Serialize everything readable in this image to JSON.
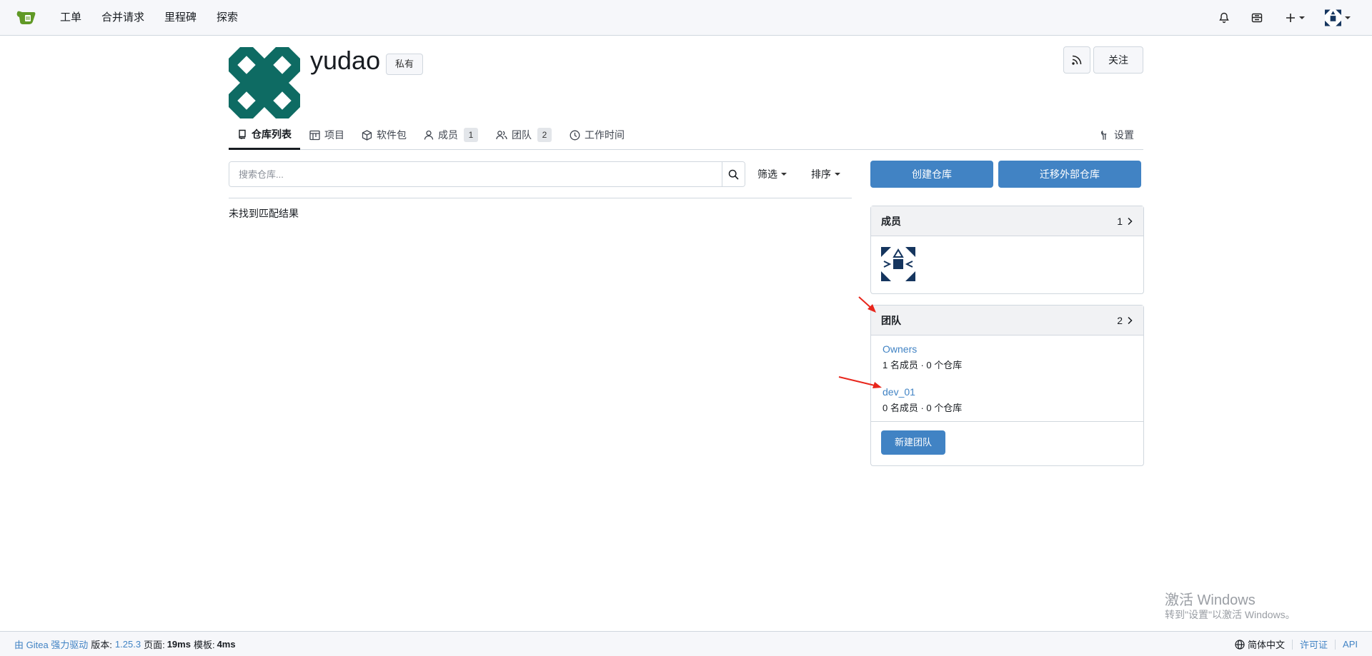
{
  "nav": {
    "items": [
      "工单",
      "合并请求",
      "里程碑",
      "探索"
    ],
    "icons": [
      "bell-icon",
      "inbox-icon",
      "plus-icon",
      "user-avatar"
    ]
  },
  "org": {
    "name": "yudao",
    "badge": "私有",
    "follow_label": "关注"
  },
  "tabs": {
    "repos": "仓库列表",
    "projects": "项目",
    "packages": "软件包",
    "members": "成员",
    "members_count": "1",
    "teams": "团队",
    "teams_count": "2",
    "worktime": "工作时间",
    "settings": "设置"
  },
  "search": {
    "placeholder": "搜索仓库...",
    "filter_label": "筛选",
    "sort_label": "排序",
    "no_result": "未找到匹配结果"
  },
  "actions": {
    "create_repo": "创建仓库",
    "migrate_repo": "迁移外部仓库"
  },
  "members_card": {
    "title": "成员",
    "count": "1"
  },
  "teams_card": {
    "title": "团队",
    "count": "2",
    "teams": [
      {
        "name": "Owners",
        "meta": "1 名成员 · 0 个仓库"
      },
      {
        "name": "dev_01",
        "meta": "0 名成员 · 0 个仓库"
      }
    ],
    "new_team": "新建团队"
  },
  "watermark": {
    "title": "激活 Windows",
    "subtitle": "转到\"设置\"以激活 Windows。"
  },
  "footer": {
    "powered_prefix": "由 Gitea 强力驱动",
    "version_label": "版本:",
    "version": "1.25.3",
    "page_label": "页面:",
    "page_time": "19ms",
    "tmpl_label": "模板:",
    "tmpl_time": "4ms",
    "language": "简体中文",
    "license": "许可证",
    "api": "API"
  },
  "colors": {
    "primary": "#4183c4",
    "avatar_teal": "#0e6b63",
    "annotation_arrow": "#e8261c"
  }
}
